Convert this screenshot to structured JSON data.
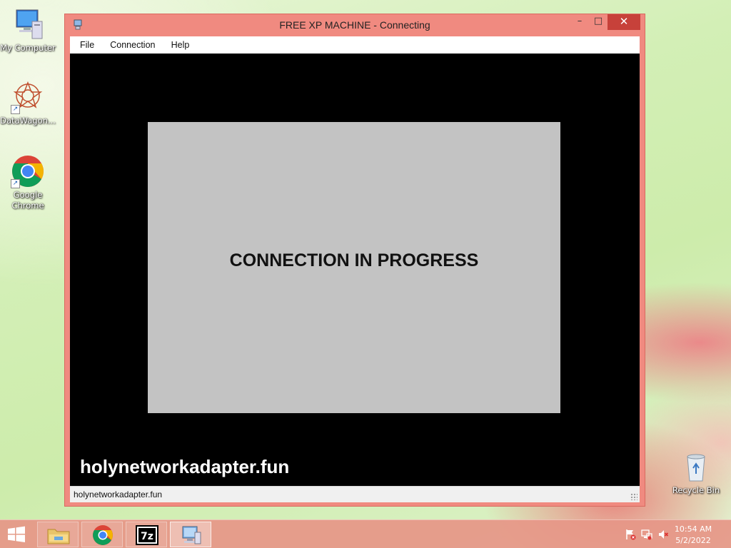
{
  "desktop": {
    "icons": [
      {
        "label": "My Computer",
        "icon": "computer-icon"
      },
      {
        "label": "DataWagon...",
        "icon": "datawagon-icon"
      },
      {
        "label": "Google Chrome",
        "icon": "chrome-icon"
      },
      {
        "label": "Recycle Bin",
        "icon": "recycle-bin-icon"
      }
    ]
  },
  "window": {
    "title": "FREE XP MACHINE - Connecting",
    "controls": {
      "minimize": "–",
      "maximize": "□",
      "close": "✕"
    },
    "menu": [
      "File",
      "Connection",
      "Help"
    ],
    "panel_text": "CONNECTION IN PROGRESS",
    "watermark": "holynetworkadapter.fun",
    "status_text": "holynetworkadapter.fun",
    "accent_color": "#f08a80",
    "close_color": "#c7413a"
  },
  "taskbar": {
    "apps": [
      {
        "name": "file-explorer",
        "icon": "folder-icon"
      },
      {
        "name": "google-chrome",
        "icon": "chrome-icon"
      },
      {
        "name": "7-zip",
        "icon": "7zip-icon",
        "text": "7z"
      },
      {
        "name": "remote-connection",
        "icon": "network-computer-icon",
        "active": true
      }
    ],
    "tray": [
      "action-center-flag-icon",
      "network-icon",
      "volume-muted-icon"
    ],
    "clock": {
      "time": "10:54 AM",
      "date": "5/2/2022"
    }
  }
}
